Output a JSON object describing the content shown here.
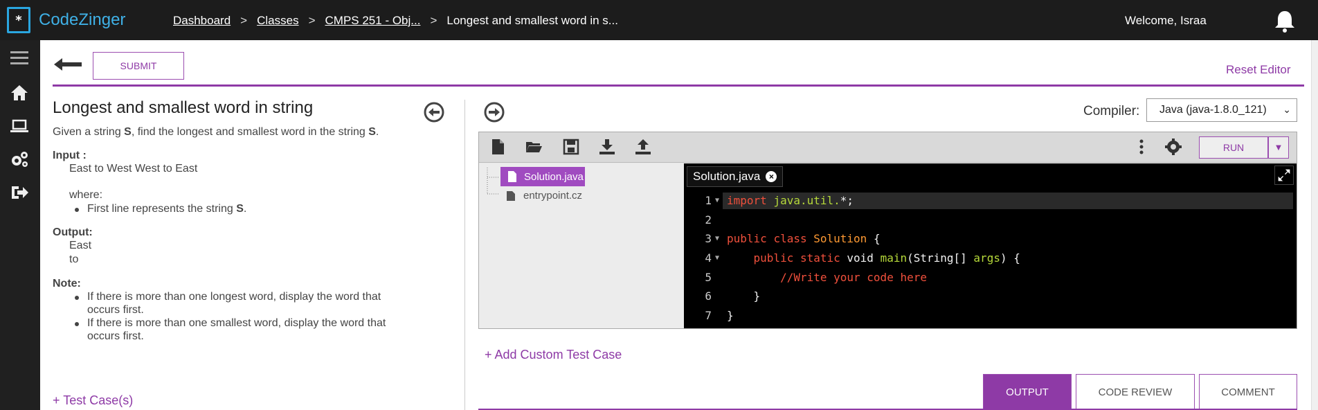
{
  "app": {
    "name": "CodeZinger"
  },
  "breadcrumbs": [
    {
      "label": "Dashboard",
      "link": true
    },
    {
      "label": "Classes",
      "link": true
    },
    {
      "label": "CMPS 251 - Obj...",
      "link": true
    },
    {
      "label": "Longest and smallest word in s...",
      "link": false
    }
  ],
  "breadcrumb_sep": ">",
  "header": {
    "welcome": "Welcome, Israa"
  },
  "toolbar": {
    "submit_label": "SUBMIT",
    "reset_label": "Reset Editor"
  },
  "problem": {
    "title": "Longest and smallest word in string",
    "desc_pre": "Given a string ",
    "desc_s": "S",
    "desc_mid": ", find the longest and smallest word in the string ",
    "desc_s2": "S",
    "desc_end": ".",
    "input_label": "Input :",
    "input_value": "East to West West to East",
    "where_label": "where:",
    "where_bullet_pre": "First line represents the string ",
    "where_bullet_s": "S",
    "where_bullet_end": ".",
    "output_label": "Output:",
    "output_lines": [
      "East",
      "to"
    ],
    "note_label": "Note:",
    "notes": [
      [
        "If there is more than one longest word, display the word that",
        "occurs first."
      ],
      [
        "If there is more than one smallest word, display the word that",
        "occurs first."
      ]
    ],
    "test_cases_label": "+ Test Case(s)"
  },
  "compiler": {
    "label": "Compiler:",
    "selected": "Java (java-1.8.0_121)"
  },
  "editor": {
    "run_label": "RUN",
    "files": [
      "Solution.java",
      "entrypoint.cz"
    ],
    "active_tab": "Solution.java",
    "code_lines": [
      {
        "n": "1",
        "fold": true
      },
      {
        "n": "2",
        "fold": false
      },
      {
        "n": "3",
        "fold": true
      },
      {
        "n": "4",
        "fold": true
      },
      {
        "n": "5",
        "fold": false
      },
      {
        "n": "6",
        "fold": false
      },
      {
        "n": "7",
        "fold": false
      }
    ],
    "code": {
      "l1_import": "import",
      "l1_pkg": "java.util.",
      "l1_rest": "*;",
      "l3_public": "public",
      "l3_class": "class",
      "l3_name": "Solution",
      "l3_brace": " {",
      "l4_public": "public",
      "l4_static": "static",
      "l4_void": " void ",
      "l4_main": "main",
      "l4_params": "(String[] ",
      "l4_args": "args",
      "l4_end": ") {",
      "l5_comment": "//Write your code here",
      "l6": "}",
      "l7": "}"
    }
  },
  "add_custom_test": "+ Add Custom Test Case",
  "bottom_tabs": [
    "OUTPUT",
    "CODE REVIEW",
    "COMMENT"
  ],
  "colors": {
    "accent": "#8e3aa6",
    "logo": "#2aa6e0",
    "header_bg": "#1c1c1c"
  }
}
